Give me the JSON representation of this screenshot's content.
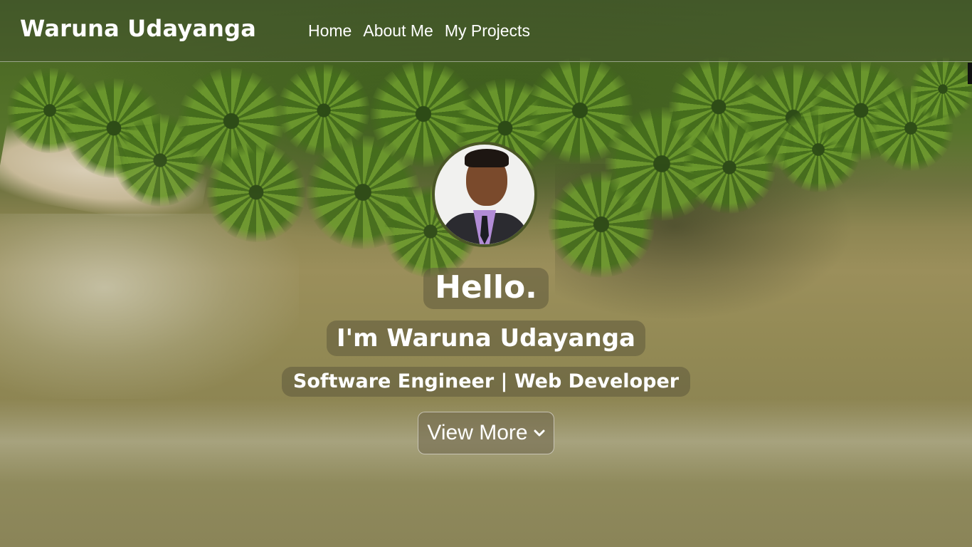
{
  "navbar": {
    "brand": "Waruna Udayanga",
    "links": [
      {
        "label": "Home"
      },
      {
        "label": "About Me"
      },
      {
        "label": "My Projects"
      }
    ]
  },
  "hero": {
    "greeting": "Hello.",
    "name_line": "I'm Waruna Udayanga",
    "role_line": "Software Engineer | Web Developer",
    "cta_label": "View More",
    "cta_icon": "chevron-down-icon"
  },
  "colors": {
    "text": "#ffffff",
    "navbar_bg": "#46552d",
    "avatar_border": "#4a5626"
  }
}
